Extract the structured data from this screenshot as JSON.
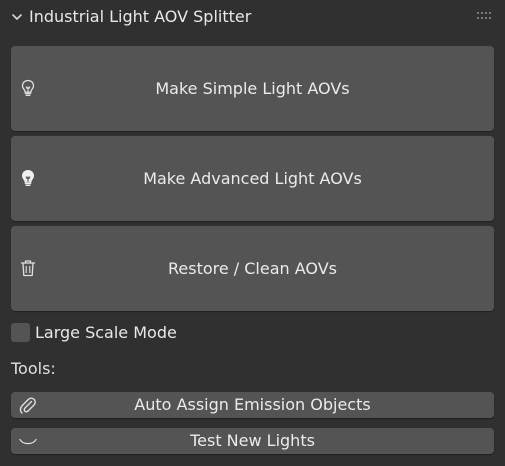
{
  "panel": {
    "title": "Industrial Light AOV Splitter",
    "collapse_icon": "chevron-down-icon",
    "drag_icon": "drag-grip-icon"
  },
  "actions": [
    {
      "label": "Make Simple Light AOVs",
      "icon": "light-bulb-outline-icon"
    },
    {
      "label": "Make Advanced Light AOVs",
      "icon": "light-bulb-filled-icon"
    },
    {
      "label": "Restore / Clean AOVs",
      "icon": "trash-icon"
    }
  ],
  "large_scale_mode": {
    "label": "Large Scale Mode",
    "checked": false
  },
  "tools": {
    "heading": "Tools:",
    "items": [
      {
        "label": "Auto Assign Emission Objects",
        "icon": "paperclip-icon"
      },
      {
        "label": "Test New Lights",
        "icon": "arc-icon"
      }
    ]
  },
  "colors": {
    "background": "#303030",
    "button": "#545454",
    "text": "#e6e6e6"
  }
}
